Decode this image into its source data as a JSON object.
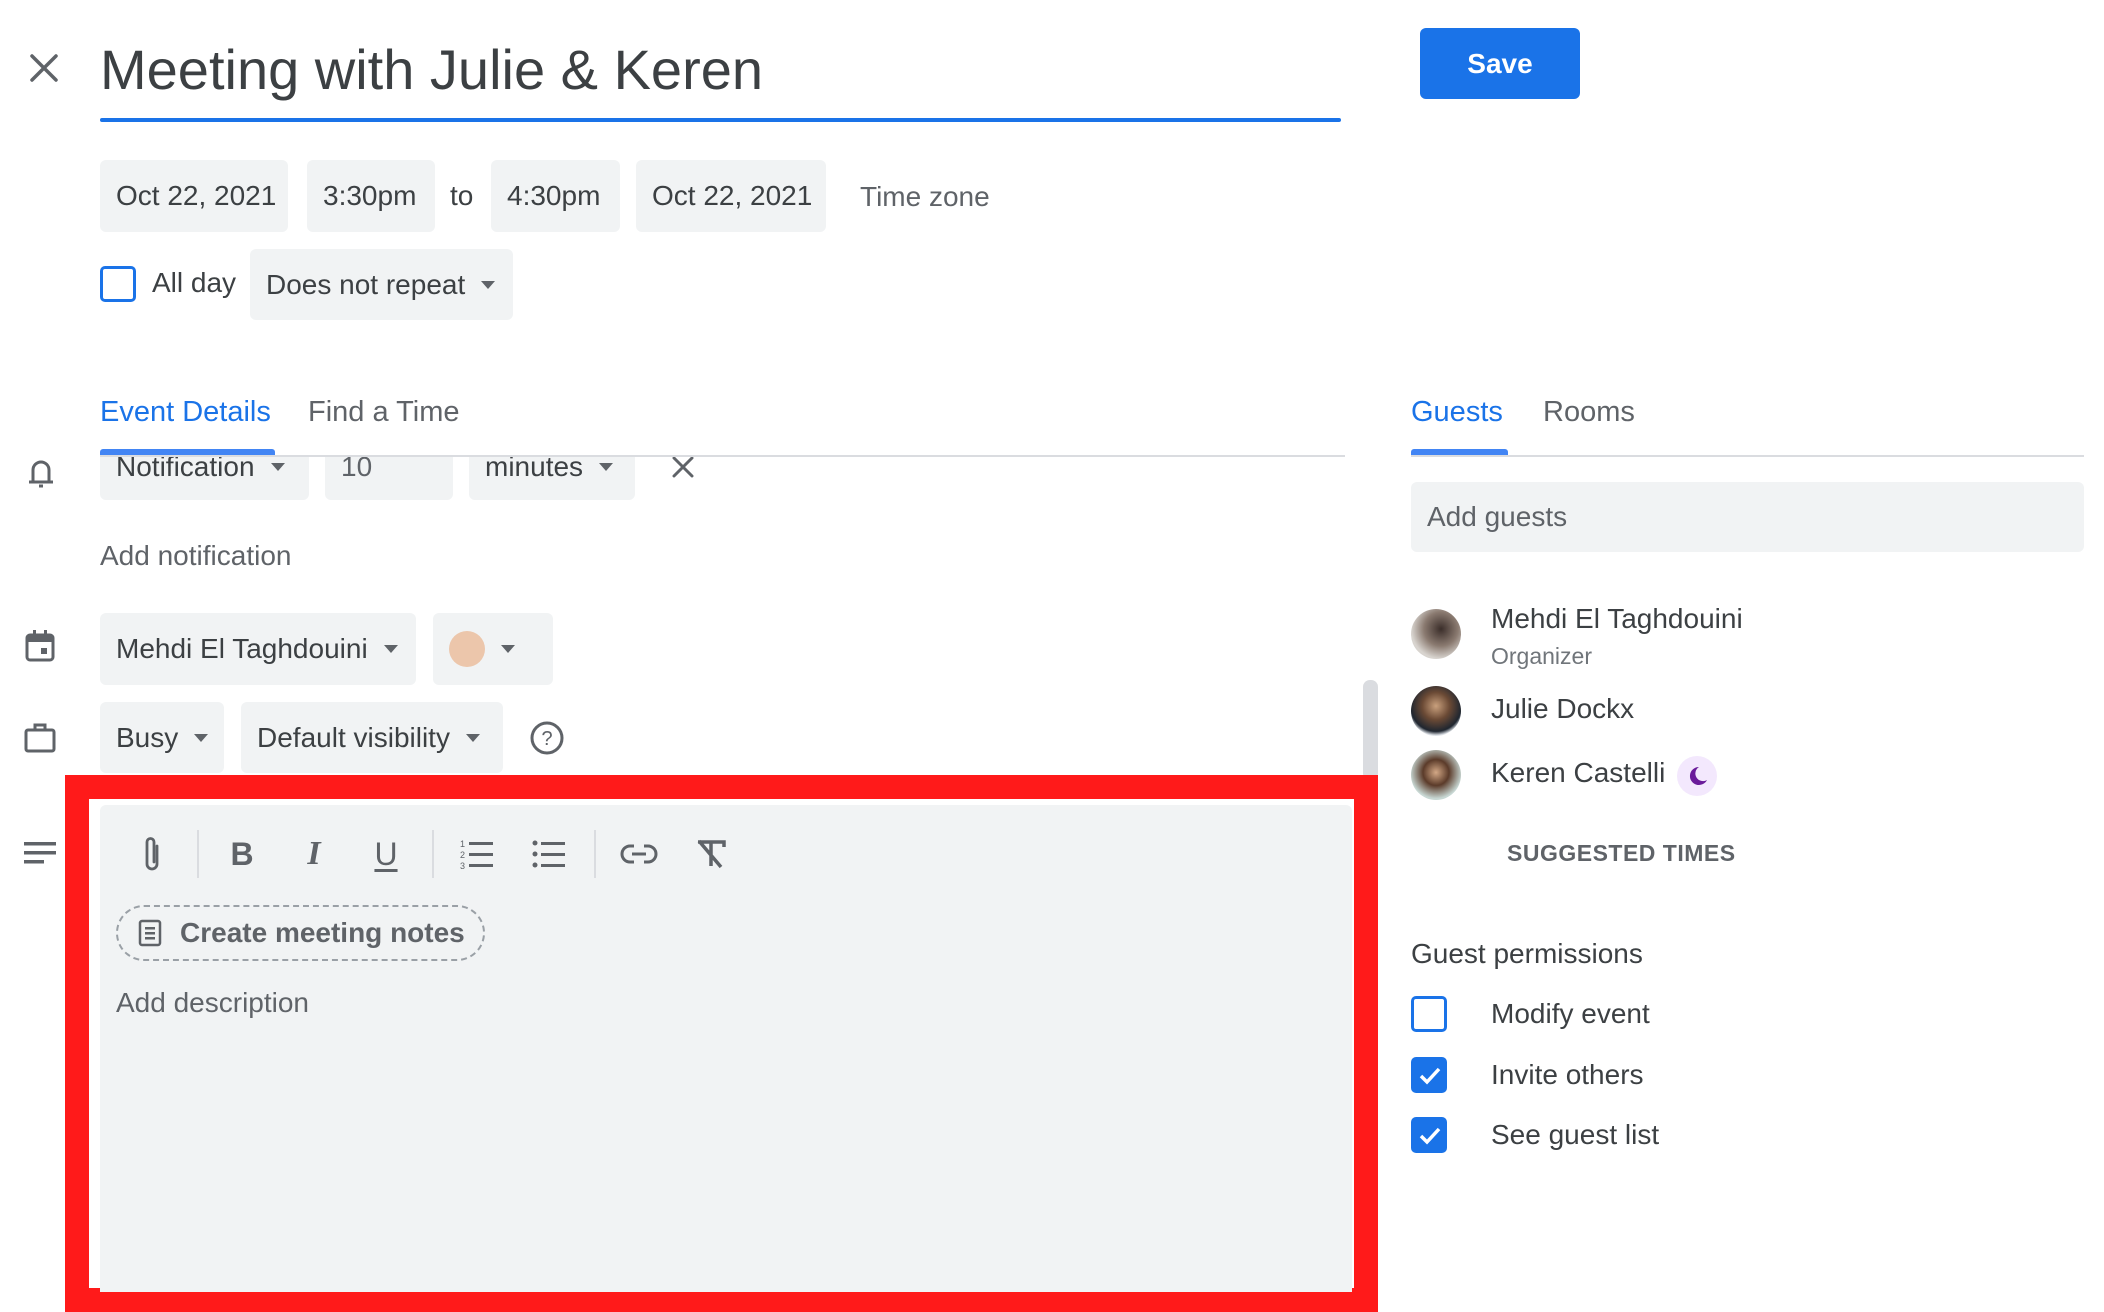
{
  "header": {
    "close_icon": "close-icon",
    "title": "Meeting with Julie & Keren",
    "save_label": "Save"
  },
  "datetime": {
    "start_date": "Oct 22, 2021",
    "start_time": "3:30pm",
    "to_label": "to",
    "end_time": "4:30pm",
    "end_date": "Oct 22, 2021",
    "time_zone_label": "Time zone",
    "all_day_label": "All day",
    "all_day_checked": false,
    "repeat_value": "Does not repeat"
  },
  "tabs": {
    "left": [
      {
        "label": "Event Details",
        "active": true
      },
      {
        "label": "Find a Time",
        "active": false
      }
    ],
    "right": [
      {
        "label": "Guests",
        "active": true
      },
      {
        "label": "Rooms",
        "active": false
      }
    ]
  },
  "details": {
    "notification": {
      "type": "Notification",
      "amount": "10",
      "unit": "minutes"
    },
    "add_notification_label": "Add notification",
    "calendar_owner": "Mehdi El Taghdouini",
    "event_color": "#ecc6ab",
    "availability": "Busy",
    "visibility": "Default visibility"
  },
  "editor": {
    "toolbar": [
      {
        "name": "attachment-icon",
        "title": "Attachment"
      },
      {
        "name": "bold-icon",
        "title": "Bold"
      },
      {
        "name": "italic-icon",
        "title": "Italic"
      },
      {
        "name": "underline-icon",
        "title": "Underline"
      },
      {
        "name": "numbered-list-icon",
        "title": "Numbered list"
      },
      {
        "name": "bulleted-list-icon",
        "title": "Bulleted list"
      },
      {
        "name": "link-icon",
        "title": "Link"
      },
      {
        "name": "remove-formatting-icon",
        "title": "Remove formatting"
      }
    ],
    "create_notes_label": "Create meeting notes",
    "description_placeholder": "Add description"
  },
  "guests": {
    "add_placeholder": "Add guests",
    "list": [
      {
        "name": "Mehdi El Taghdouini",
        "role": "Organizer"
      },
      {
        "name": "Julie Dockx",
        "role": ""
      },
      {
        "name": "Keren Castelli",
        "role": "",
        "status_icon": "moon-icon"
      }
    ],
    "suggested_times_label": "SUGGESTED TIMES",
    "permissions_title": "Guest permissions",
    "permissions": [
      {
        "label": "Modify event",
        "checked": false
      },
      {
        "label": "Invite others",
        "checked": true
      },
      {
        "label": "See guest list",
        "checked": true
      }
    ]
  },
  "colors": {
    "accent": "#1a73e8",
    "highlight_box": "#ff1a1a",
    "chip_bg": "#f1f3f4",
    "do_not_disturb": "#6a1b9a"
  }
}
